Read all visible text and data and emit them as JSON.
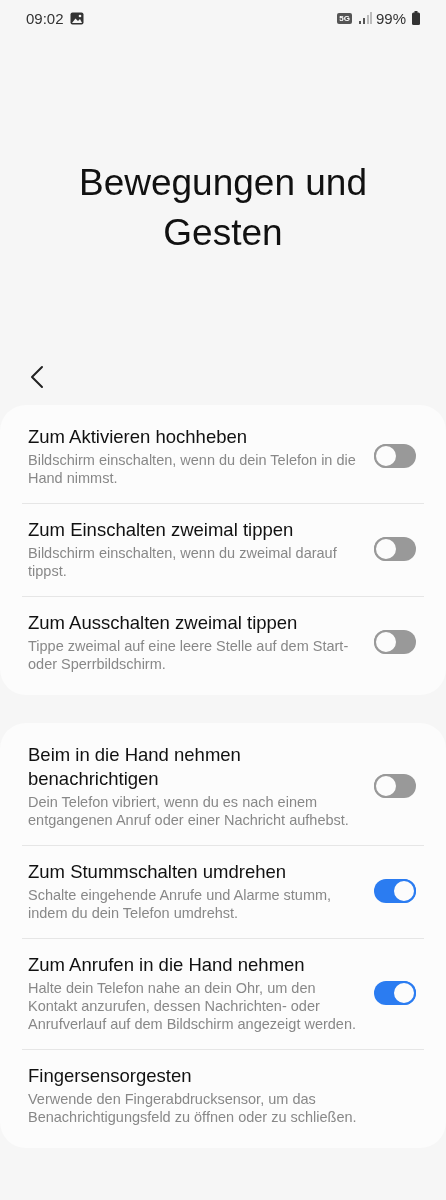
{
  "status_bar": {
    "time": "09:02",
    "network": "5G",
    "battery": "99%"
  },
  "title": "Bewegungen und Gesten",
  "groups": [
    {
      "items": [
        {
          "kind": "toggle",
          "title": "Zum Aktivieren hochheben",
          "description": "Bildschirm einschalten, wenn du dein Telefon in die Hand nimmst.",
          "on": false
        },
        {
          "kind": "toggle",
          "title": "Zum Einschalten zweimal tippen",
          "description": "Bildschirm einschalten, wenn du zweimal darauf tippst.",
          "on": false
        },
        {
          "kind": "toggle",
          "title": "Zum Ausschalten zweimal tippen",
          "description": "Tippe zweimal auf eine leere Stelle auf dem Start- oder Sperrbildschirm.",
          "on": false
        }
      ]
    },
    {
      "items": [
        {
          "kind": "toggle",
          "title": "Beim in die Hand nehmen benachrichtigen",
          "description": "Dein Telefon vibriert, wenn du es nach einem entgangenen Anruf oder einer Nachricht aufhebst.",
          "on": false
        },
        {
          "kind": "toggle",
          "title": "Zum Stummschalten umdrehen",
          "description": "Schalte eingehende Anrufe und Alarme stumm, indem du dein Telefon umdrehst.",
          "on": true
        },
        {
          "kind": "toggle",
          "title": "Zum Anrufen in die Hand nehmen",
          "description": "Halte dein Telefon nahe an dein Ohr, um den Kontakt anzurufen, dessen Nachrichten- oder Anrufverlauf auf dem Bildschirm angezeigt werden.",
          "on": true
        },
        {
          "kind": "link",
          "title": "Fingersensorgesten",
          "description": "Verwende den Fingerabdrucksensor, um das Benachrichtigungsfeld zu öffnen oder zu schließen."
        }
      ]
    }
  ]
}
